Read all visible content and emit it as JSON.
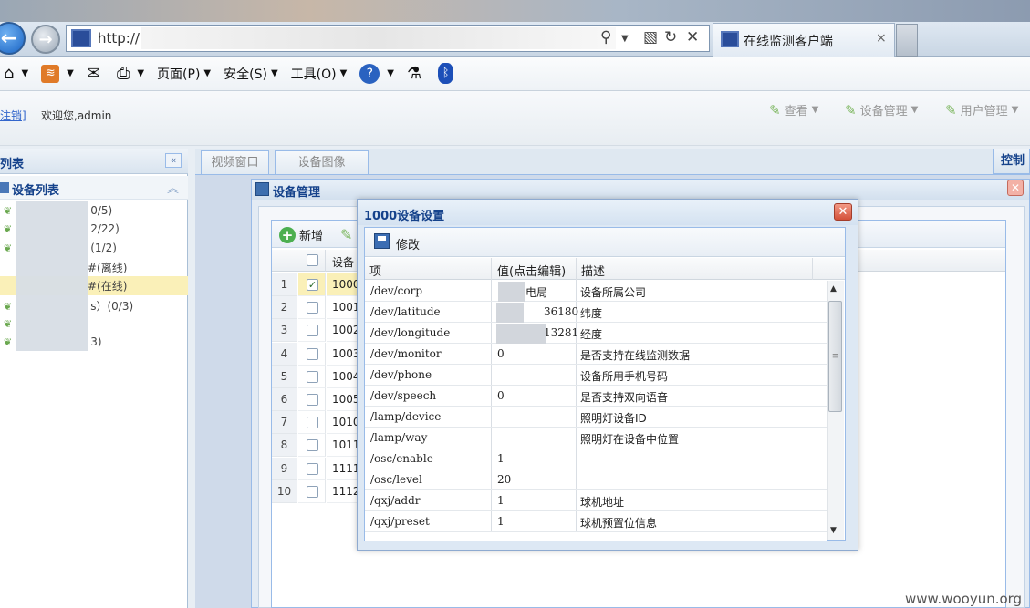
{
  "browser": {
    "url_prefix": "http://",
    "tab_title": "在线监测客户端",
    "tab_close": "×",
    "menus": [
      {
        "label": "页面(P)"
      },
      {
        "label": "安全(S)"
      },
      {
        "label": "工具(O)"
      }
    ]
  },
  "header": {
    "logout": "注销]",
    "welcome": "欢迎您,admin",
    "menus": [
      "查看",
      "设备管理",
      "用户管理"
    ]
  },
  "left_panel": {
    "title": "列表",
    "device_list_title": "设备列表",
    "tree_items": [
      "0/5)",
      "2/22)",
      "(1/2)",
      "#(离线)",
      "#(在线)",
      "s）(0/3)",
      "",
      "3)"
    ]
  },
  "center": {
    "tabs": [
      "视频窗口",
      "设备图像"
    ],
    "control_tab": "控制"
  },
  "device_mgmt": {
    "title": "设备管理",
    "add_button": "新增",
    "col_device": "设备",
    "rows": [
      {
        "num": "1",
        "id": "1000",
        "checked": true
      },
      {
        "num": "2",
        "id": "1001",
        "checked": false
      },
      {
        "num": "3",
        "id": "1002",
        "checked": false
      },
      {
        "num": "4",
        "id": "1003",
        "checked": false
      },
      {
        "num": "5",
        "id": "1004",
        "checked": false
      },
      {
        "num": "6",
        "id": "1005",
        "checked": false
      },
      {
        "num": "7",
        "id": "1010",
        "checked": false
      },
      {
        "num": "8",
        "id": "1011",
        "checked": false
      },
      {
        "num": "9",
        "id": "1111",
        "checked": false
      },
      {
        "num": "10",
        "id": "1112",
        "checked": false
      }
    ]
  },
  "modal": {
    "title": "1000设备设置",
    "save_label": "修改",
    "columns": [
      "项",
      "值(点击编辑)",
      "描述"
    ],
    "rows": [
      {
        "key": "/dev/corp",
        "value": "电局",
        "desc": "设备所属公司"
      },
      {
        "key": "/dev/latitude",
        "value": "36180",
        "desc": "纬度"
      },
      {
        "key": "/dev/longitude",
        "value": "13281",
        "desc": "经度"
      },
      {
        "key": "/dev/monitor",
        "value": "0",
        "desc": "是否支持在线监测数据"
      },
      {
        "key": "/dev/phone",
        "value": "",
        "desc": "设备所用手机号码"
      },
      {
        "key": "/dev/speech",
        "value": "0",
        "desc": "是否支持双向语音"
      },
      {
        "key": "/lamp/device",
        "value": "",
        "desc": "照明灯设备ID"
      },
      {
        "key": "/lamp/way",
        "value": "",
        "desc": "照明灯在设备中位置"
      },
      {
        "key": "/osc/enable",
        "value": "1",
        "desc": ""
      },
      {
        "key": "/osc/level",
        "value": "20",
        "desc": ""
      },
      {
        "key": "/qxj/addr",
        "value": "1",
        "desc": "球机地址"
      },
      {
        "key": "/qxj/preset",
        "value": "1",
        "desc": "球机预置位信息"
      }
    ]
  },
  "watermark": "www.wooyun.org"
}
